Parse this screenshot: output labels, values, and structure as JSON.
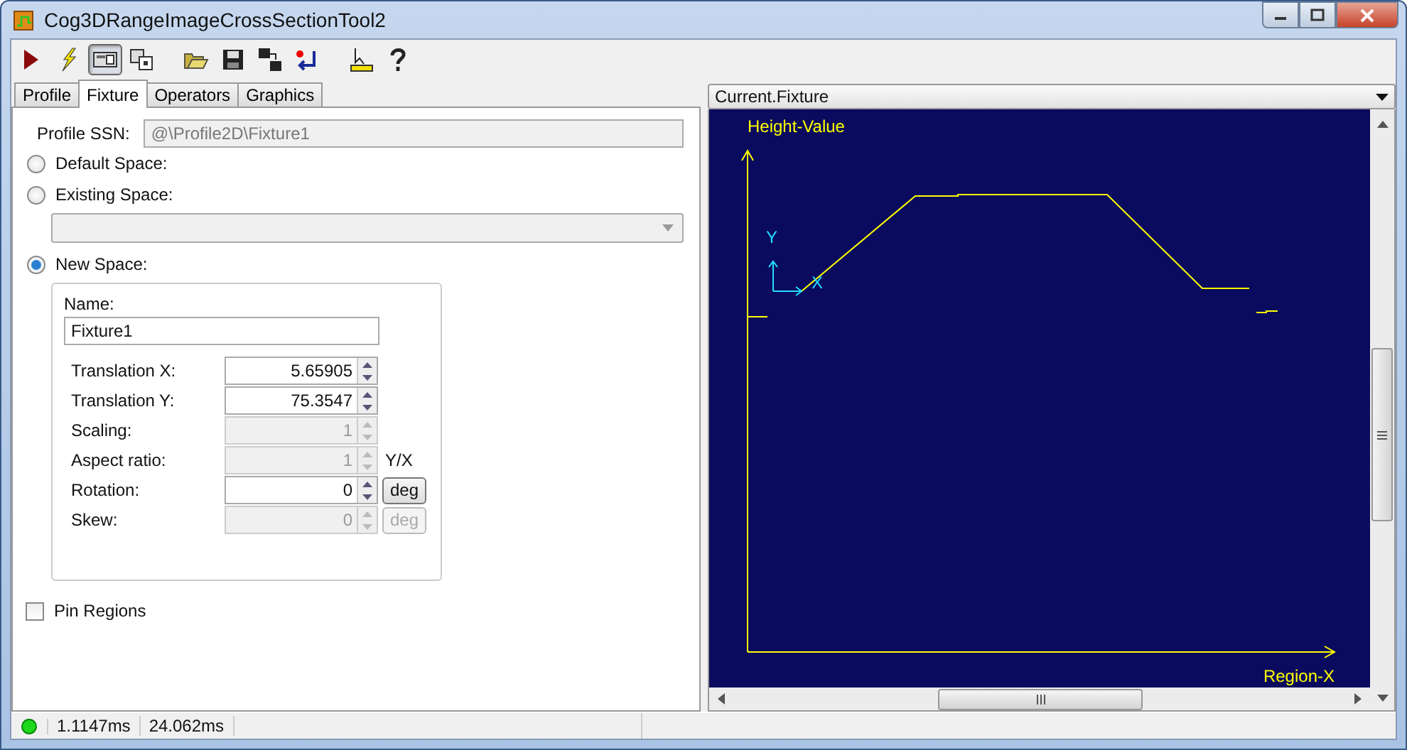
{
  "window": {
    "title": "Cog3DRangeImageCrossSectionTool2"
  },
  "toolbar": [
    {
      "kind": "run",
      "selected": false
    },
    {
      "kind": "lightning",
      "selected": false
    },
    {
      "kind": "image-view",
      "selected": true
    },
    {
      "kind": "window-view",
      "selected": false
    },
    {
      "kind": "open",
      "selected": false
    },
    {
      "kind": "save",
      "selected": false
    },
    {
      "kind": "save-as",
      "selected": false
    },
    {
      "kind": "reset",
      "selected": false
    },
    {
      "kind": "pointer-ruler",
      "selected": false
    },
    {
      "kind": "help",
      "selected": false
    }
  ],
  "tabs": [
    {
      "label": "Profile",
      "selected": false
    },
    {
      "label": "Fixture",
      "selected": true
    },
    {
      "label": "Operators",
      "selected": false
    },
    {
      "label": "Graphics",
      "selected": false
    }
  ],
  "fixture": {
    "profile_ssn": {
      "label": "Profile SSN:",
      "value": "@\\Profile2D\\Fixture1"
    },
    "spaces": [
      {
        "label": "Default Space:",
        "selected": false
      },
      {
        "label": "Existing Space:",
        "selected": false
      },
      {
        "label": "New Space:",
        "selected": true
      }
    ],
    "name": {
      "label": "Name:",
      "value": "Fixture1"
    },
    "params": [
      {
        "label": "Translation X:",
        "value": "5.65905",
        "disabled": false
      },
      {
        "label": "Translation Y:",
        "value": "75.3547",
        "disabled": false
      },
      {
        "label": "Scaling:",
        "value": "1",
        "disabled": true
      },
      {
        "label": "Aspect ratio:",
        "value": "1",
        "disabled": true,
        "suffix": {
          "kind": "text",
          "text": "Y/X"
        }
      },
      {
        "label": "Rotation:",
        "value": "0",
        "disabled": false,
        "suffix": {
          "kind": "button",
          "text": "deg"
        }
      },
      {
        "label": "Skew:",
        "value": "0",
        "disabled": true,
        "suffix": {
          "kind": "button",
          "text": "deg"
        }
      }
    ],
    "pin_regions": {
      "label": "Pin Regions",
      "checked": false
    }
  },
  "view": {
    "selector": "Current.Fixture",
    "y_axis_label": "Height-Value",
    "x_axis_label": "Region-X",
    "fixture_x_label": "X",
    "fixture_y_label": "Y"
  },
  "status_bar": {
    "times": [
      "1.1147ms",
      "24.062ms"
    ]
  }
}
